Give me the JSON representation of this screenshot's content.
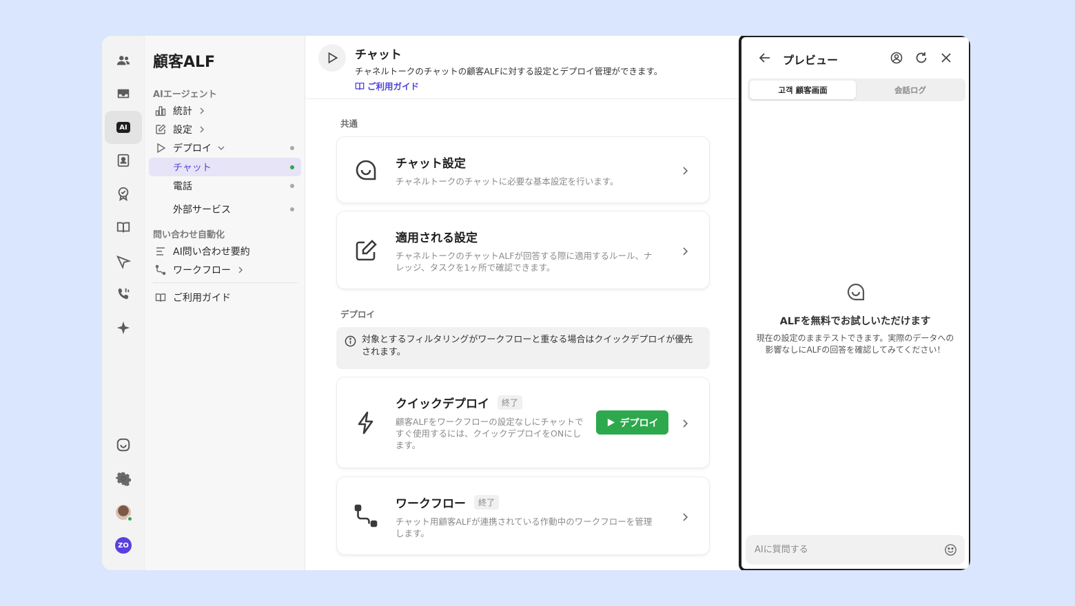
{
  "sidebar": {
    "title": "顧客ALF",
    "sections": {
      "ai_agent": "AIエージェント",
      "automation": "問い合わせ自動化"
    },
    "items": {
      "stats": "統計",
      "settings": "設定",
      "deploy": "デプロイ",
      "chat": "チャット",
      "phone": "電話",
      "external": "外部サービス",
      "ai_summary": "AI問い合わせ要約",
      "workflow": "ワークフロー",
      "guide": "ご利用ガイド"
    }
  },
  "rail": {
    "ai_label": "AI",
    "profile_initials": "ZO"
  },
  "header": {
    "title": "チャット",
    "description": "チャネルトークのチャットの顧客ALFに対する設定とデプロイ管理ができます。",
    "guide_link": "ご利用ガイド"
  },
  "sections": {
    "common": "共通",
    "deploy": "デプロイ"
  },
  "cards": {
    "chat_settings": {
      "title": "チャット設定",
      "description": "チャネルトークのチャットに必要な基本設定を行います。"
    },
    "applied_settings": {
      "title": "適用される設定",
      "description": "チャネルトークのチャットALFが回答する際に適用するルール、ナレッジ、タスクを1ヶ所で確認できます。"
    },
    "quick_deploy": {
      "title": "クイックデプロイ",
      "badge": "終了",
      "description": "顧客ALFをワークフローの設定なしにチャットですぐ使用するには、クイックデプロイをONにします。",
      "button": "デプロイ"
    },
    "workflow": {
      "title": "ワークフロー",
      "badge": "終了",
      "description": "チャット用顧客ALFが連携されている作動中のワークフローを管理します。"
    }
  },
  "info": "対象とするフィルタリングがワークフローと重なる場合はクイックデプロイが優先されます。",
  "preview": {
    "title": "プレビュー",
    "tabs": [
      "고객 顧客画面",
      "会話ログ"
    ],
    "empty_title": "ALFを無料でお試しいただけます",
    "empty_desc": "現在の設定のままテストできます。実際のデータへの影響なしにALFの回答を確認してみてください！",
    "input_placeholder": "AIに質問する"
  },
  "colors": {
    "accent": "#5a4ad6",
    "deploy_green": "#2ea84d",
    "background": "#d9e6fd"
  }
}
